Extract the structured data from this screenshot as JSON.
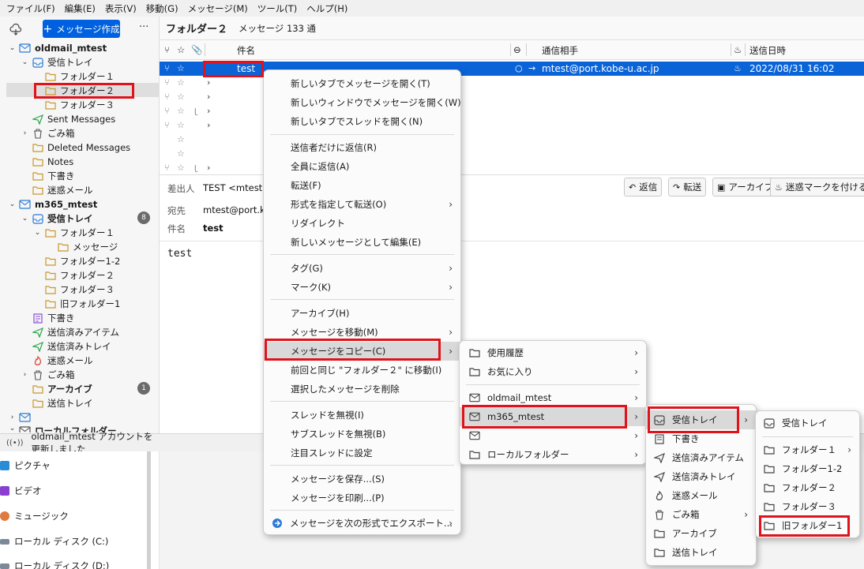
{
  "menubar": [
    "ファイル(F)",
    "編集(E)",
    "表示(V)",
    "移動(G)",
    "メッセージ(M)",
    "ツール(T)",
    "ヘルプ(H)"
  ],
  "left": {
    "compose_label": "メッセージ作成",
    "more": "···",
    "tree": [
      {
        "label": "oldmail_mtest",
        "bold": true
      },
      {
        "label": "受信トレイ"
      },
      {
        "label": "フォルダー１"
      },
      {
        "label": "フォルダー２"
      },
      {
        "label": "フォルダー３"
      },
      {
        "label": "Sent Messages"
      },
      {
        "label": "ごみ箱"
      },
      {
        "label": "Deleted Messages"
      },
      {
        "label": "Notes"
      },
      {
        "label": "下書き"
      },
      {
        "label": "迷惑メール"
      },
      {
        "label": "m365_mtest",
        "bold": true
      },
      {
        "label": "受信トレイ",
        "bold": true,
        "badge": "8"
      },
      {
        "label": "フォルダー１"
      },
      {
        "label": "メッセージ"
      },
      {
        "label": "フォルダー1-2"
      },
      {
        "label": "フォルダー２"
      },
      {
        "label": "フォルダー３"
      },
      {
        "label": "旧フォルダー1"
      },
      {
        "label": "下書き"
      },
      {
        "label": "送信済みアイテム"
      },
      {
        "label": "送信済みトレイ"
      },
      {
        "label": "迷惑メール"
      },
      {
        "label": "ごみ箱"
      },
      {
        "label": "アーカイブ",
        "bold": true,
        "badge": "1"
      },
      {
        "label": "送信トレイ"
      },
      {
        "label": ""
      },
      {
        "label": "ローカルフォルダー",
        "bold": true
      }
    ],
    "status": "oldmail_mtest アカウントを更新しました"
  },
  "explorer": [
    "ピクチャ",
    "ビデオ",
    "ミュージック",
    "ローカル ディスク (C:)",
    "ローカル ディスク (D:)"
  ],
  "main": {
    "folder_name": "フォルダー２",
    "message_count": "メッセージ 133 通",
    "columns": {
      "subject": "件名",
      "correspondent": "通信相手",
      "date": "送信日時"
    },
    "selected_message": {
      "subject": "test",
      "correspondent": "mtest@port.kobe-u.ac.jp",
      "date": "2022/08/31 16:02"
    },
    "header": {
      "from_label": "差出人",
      "from_value": "TEST <mtest@",
      "to_label": "宛先",
      "to_value": "mtest@port.ko",
      "subject_label": "件名",
      "subject_value": "test"
    },
    "actions": [
      "返信",
      "転送",
      "アーカイブ",
      "迷惑マークを付ける"
    ],
    "body": "test"
  },
  "context_menu": [
    "新しいタブでメッセージを開く(T)",
    "新しいウィンドウでメッセージを開く(W)",
    "新しいタブでスレッドを開く(N)",
    "送信者だけに返信(R)",
    "全員に返信(A)",
    "転送(F)",
    "形式を指定して転送(O)",
    "リダイレクト",
    "新しいメッセージとして編集(E)",
    "タグ(G)",
    "マーク(K)",
    "アーカイブ(H)",
    "メッセージを移動(M)",
    "メッセージをコピー(C)",
    "前回と同じ \"フォルダー２\" に移動(I)",
    "選択したメッセージを削除",
    "スレッドを無視(I)",
    "サブスレッドを無視(B)",
    "注目スレッドに設定",
    "メッセージを保存...(S)",
    "メッセージを印刷...(P)",
    "メッセージを次の形式でエクスポート..."
  ],
  "submenu1": [
    "使用履歴",
    "お気に入り",
    "oldmail_mtest",
    "m365_mtest",
    "",
    "ローカルフォルダー"
  ],
  "submenu2": [
    "受信トレイ",
    "下書き",
    "送信済みアイテム",
    "送信済みトレイ",
    "迷惑メール",
    "ごみ箱",
    "アーカイブ",
    "送信トレイ"
  ],
  "submenu3": [
    "受信トレイ",
    "フォルダー１",
    "フォルダー1-2",
    "フォルダー２",
    "フォルダー３",
    "旧フォルダー1"
  ],
  "colors": {
    "accent": "#0061e0",
    "selection": "#0a64d8",
    "highlight_box": "#e0121a",
    "folder": "#f2c14e"
  }
}
